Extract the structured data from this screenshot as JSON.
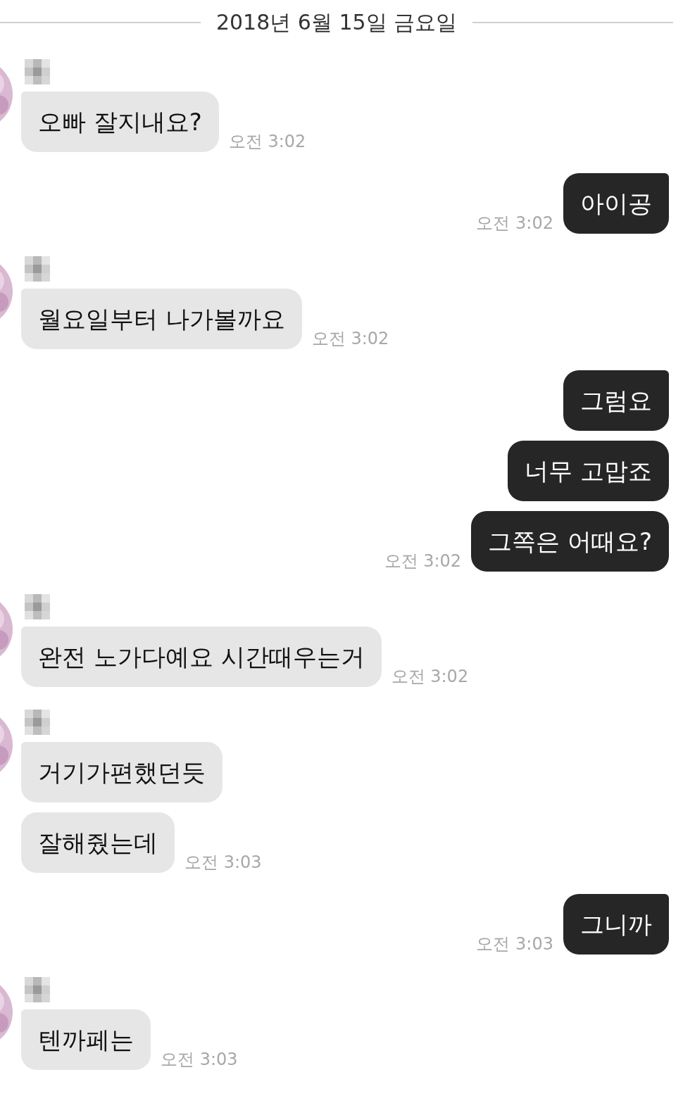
{
  "date_divider": "2018년 6월 15일 금요일",
  "messages": [
    {
      "kind": "received",
      "bubbles": [
        "오빠 잘지내요?"
      ],
      "time": "오전 3:02"
    },
    {
      "kind": "sent",
      "bubbles": [
        "아이공"
      ],
      "time": "오전 3:02"
    },
    {
      "kind": "received",
      "bubbles": [
        "월요일부터 나가볼까요"
      ],
      "time": "오전 3:02"
    },
    {
      "kind": "sent",
      "bubbles": [
        "그럼요",
        "너무 고맙죠",
        "그쪽은 어때요?"
      ],
      "time": "오전 3:02"
    },
    {
      "kind": "received",
      "bubbles": [
        "완전 노가다예요 시간때우는거"
      ],
      "time": "오전 3:02"
    },
    {
      "kind": "received",
      "bubbles": [
        "거기가편했던듯",
        "잘해줬는데"
      ],
      "time": "오전 3:03"
    },
    {
      "kind": "sent",
      "bubbles": [
        "그니까"
      ],
      "time": "오전 3:03"
    },
    {
      "kind": "received",
      "bubbles": [
        "텐까페는"
      ],
      "time": "오전 3:03"
    }
  ]
}
